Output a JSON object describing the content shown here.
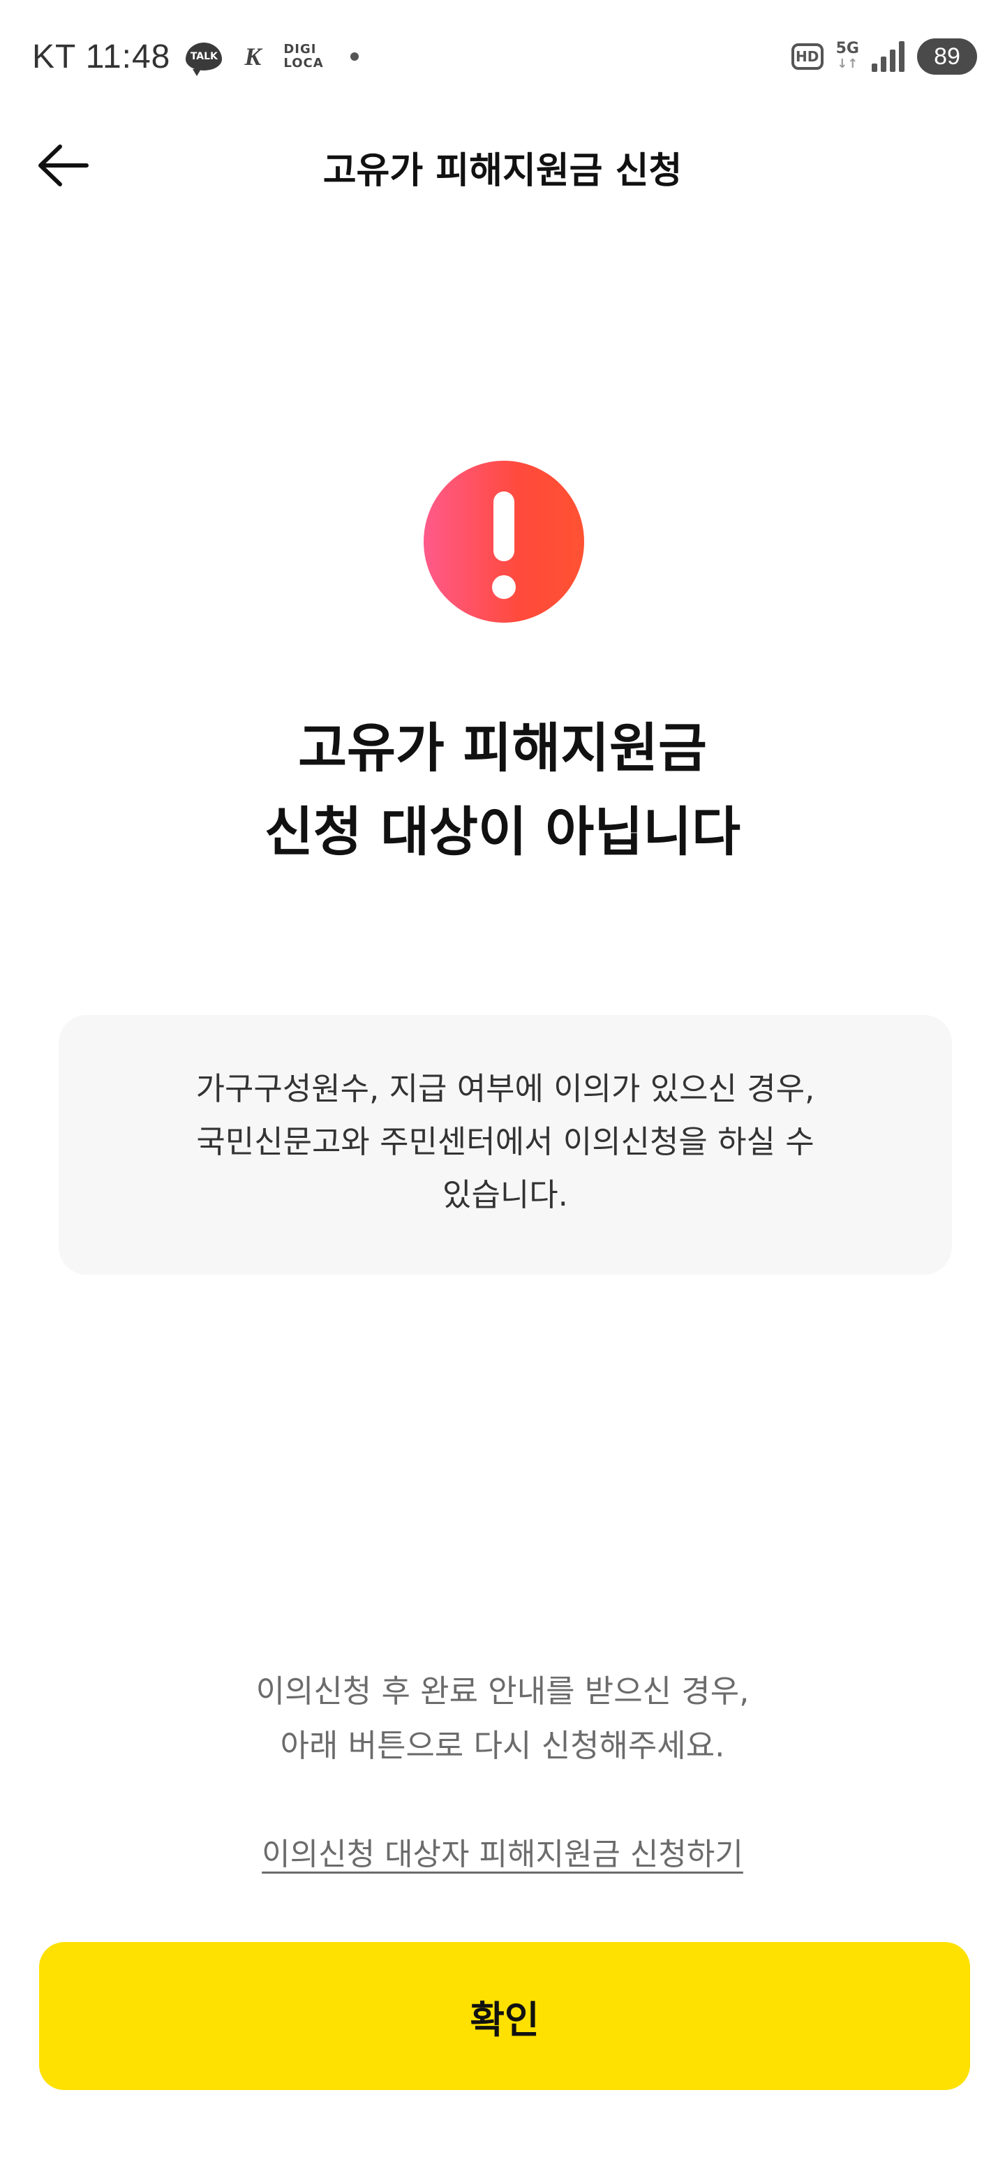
{
  "status_bar": {
    "carrier_time": "KT 11:48",
    "talk_label": "TALK",
    "k1_label": "K",
    "digi_line1": "DIGI",
    "digi_line2": "LOCA",
    "hd_label": "HD",
    "network_label": "5G",
    "network_arrows": "↓↑",
    "battery_level": "89"
  },
  "header": {
    "title": "고유가 피해지원금 신청"
  },
  "result": {
    "title_line1": "고유가 피해지원금",
    "title_line2": "신청 대상이 아닙니다",
    "accent_color": "#ff4a4a"
  },
  "info_box": {
    "line1": "가구구성원수, 지급 여부에 이의가 있으신 경우,",
    "line2": "국민신문고와 주민센터에서 이의신청을 하실 수",
    "line3": "있습니다."
  },
  "retry": {
    "note_line1": "이의신청 후 완료 안내를 받으신 경우,",
    "note_line2": "아래 버튼으로 다시 신청해주세요.",
    "link_label": "이의신청 대상자 피해지원금 신청하기"
  },
  "confirm_button": {
    "label": "확인",
    "color": "#fee100"
  }
}
